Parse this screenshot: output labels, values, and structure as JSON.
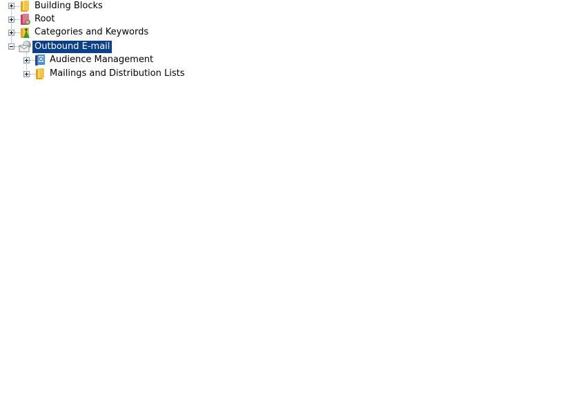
{
  "tree": {
    "nodes": [
      {
        "label": "Building Blocks",
        "icon": "folder-icon",
        "expanded": false,
        "selected": false,
        "level": 0
      },
      {
        "label": "Root",
        "icon": "root-publication-icon",
        "expanded": false,
        "selected": false,
        "level": 0
      },
      {
        "label": "Categories and Keywords",
        "icon": "categories-icon",
        "expanded": false,
        "selected": false,
        "level": 0
      },
      {
        "label": "Outbound E-mail",
        "icon": "outbound-email-icon",
        "expanded": true,
        "selected": true,
        "level": 0
      },
      {
        "label": "Audience Management",
        "icon": "audience-management-icon",
        "expanded": false,
        "selected": false,
        "level": 1
      },
      {
        "label": "Mailings and Distribution Lists",
        "icon": "folder-icon",
        "expanded": false,
        "selected": false,
        "level": 1
      }
    ]
  },
  "colors": {
    "selection_bg": "#0a3f8c",
    "selection_fg": "#ffffff"
  }
}
